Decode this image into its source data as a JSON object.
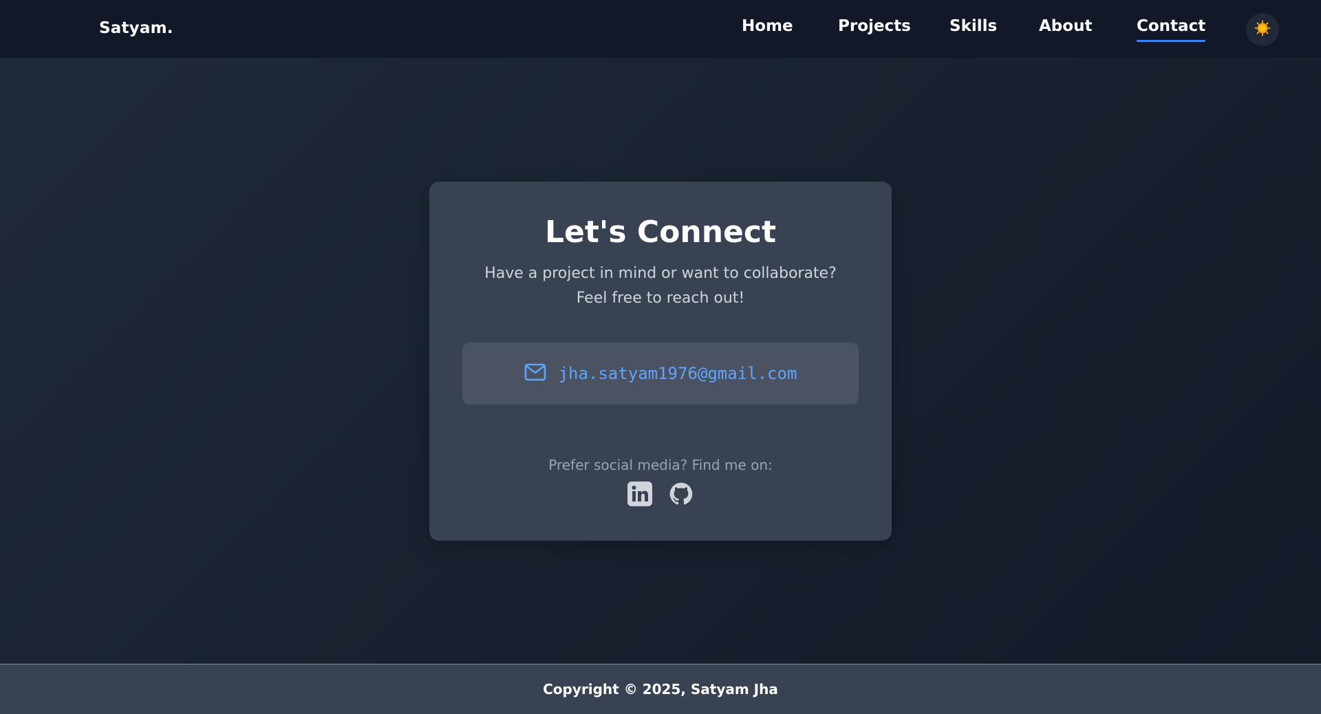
{
  "nav": {
    "brand": "Satyam.",
    "links": [
      {
        "label": "Home"
      },
      {
        "label": "Projects"
      },
      {
        "label": "Skills"
      },
      {
        "label": "About"
      },
      {
        "label": "Contact",
        "active": true
      }
    ],
    "theme_toggle_icon": "sun-icon"
  },
  "contact": {
    "title": "Let's Connect",
    "subtitle": "Have a project in mind or want to collaborate? Feel free to reach out!",
    "email": "jha.satyam1976@gmail.com",
    "email_icon": "mail-icon",
    "social_label": "Prefer social media? Find me on:",
    "social_icons": [
      "linkedin-icon",
      "github-icon"
    ]
  },
  "footer": {
    "copyright": "Copyright © 2025, Satyam Jha"
  },
  "colors": {
    "accent": "#3b82f6",
    "email_text": "#60a5fa",
    "nav_bg": "#111827",
    "card_bg": "#394253",
    "sun": "#f59e0b"
  }
}
